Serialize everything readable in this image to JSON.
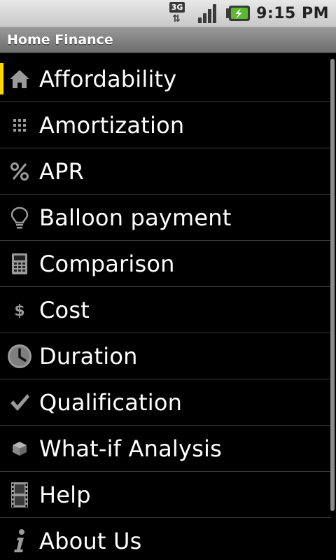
{
  "status_bar": {
    "network_label": "3G",
    "time": "9:15 PM",
    "icons": [
      "network-3g-icon",
      "signal-icon",
      "battery-charging-icon"
    ]
  },
  "title_bar": {
    "title": "Home Finance"
  },
  "menu": {
    "items": [
      {
        "label": "Affordability",
        "icon": "home-icon",
        "selected": true
      },
      {
        "label": "Amortization",
        "icon": "grid-icon"
      },
      {
        "label": "APR",
        "icon": "percent-icon"
      },
      {
        "label": "Balloon payment",
        "icon": "lightbulb-icon"
      },
      {
        "label": "Comparison",
        "icon": "calculator-icon"
      },
      {
        "label": "Cost",
        "icon": "dollar-icon"
      },
      {
        "label": "Duration",
        "icon": "clock-icon"
      },
      {
        "label": "Qualification",
        "icon": "checkmark-icon"
      },
      {
        "label": "What-if Analysis",
        "icon": "cube-icon"
      },
      {
        "label": "Help",
        "icon": "film-icon"
      },
      {
        "label": "About Us",
        "icon": "info-icon"
      }
    ]
  },
  "colors": {
    "selection_accent": "#ffd800",
    "list_background": "#000000",
    "title_bar": "#808080"
  }
}
